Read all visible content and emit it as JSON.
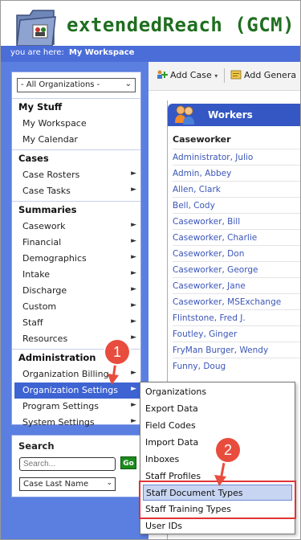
{
  "app": {
    "title": "extendedReach (GCM)",
    "breadcrumb_prefix": "you are here:",
    "breadcrumb_current": "My Workspace"
  },
  "nav": {
    "org_select": "- All Organizations -",
    "sections": {
      "my_stuff": "My Stuff",
      "cases": "Cases",
      "summaries": "Summaries",
      "administration": "Administration"
    },
    "items": {
      "my_workspace": "My Workspace",
      "my_calendar": "My Calendar",
      "case_rosters": "Case Rosters",
      "case_tasks": "Case Tasks",
      "casework": "Casework",
      "financial": "Financial",
      "demographics": "Demographics",
      "intake": "Intake",
      "discharge": "Discharge",
      "custom": "Custom",
      "staff": "Staff",
      "resources": "Resources",
      "organization_billing": "Organization Billing",
      "organization_settings": "Organization Settings",
      "program_settings": "Program Settings",
      "system_settings": "System Settings"
    }
  },
  "search": {
    "heading": "Search",
    "placeholder": "Search...",
    "go_label": "Go",
    "type_select": "Case Last Name"
  },
  "toolbar": {
    "add_case": "Add Case",
    "add_general": "Add Genera"
  },
  "workers": {
    "title": "Workers",
    "column": "Caseworker",
    "rows": [
      "Administrator, Julio",
      "Admin, Abbey",
      "Allen, Clark",
      "Bell, Cody",
      "Caseworker, Bill",
      "Caseworker, Charlie",
      "Caseworker, Don",
      "Caseworker, George",
      "Caseworker, Jane",
      "Caseworker, MSExchange",
      "Flintstone, Fred J.",
      "Foutley, Ginger",
      "FryMan Burger, Wendy",
      "Funny, Doug"
    ]
  },
  "submenu": {
    "items": [
      "Organizations",
      "Export Data",
      "Field Codes",
      "Import Data",
      "Inboxes",
      "Staff Profiles",
      "Staff Document Types",
      "Staff Training Types",
      "User IDs"
    ]
  },
  "annotations": {
    "step1": "1",
    "step2": "2"
  },
  "colors": {
    "brand_green": "#1f6e1f",
    "nav_blue": "#5b7fe0",
    "header_blue": "#3457c4",
    "highlight_red": "#e03434"
  }
}
